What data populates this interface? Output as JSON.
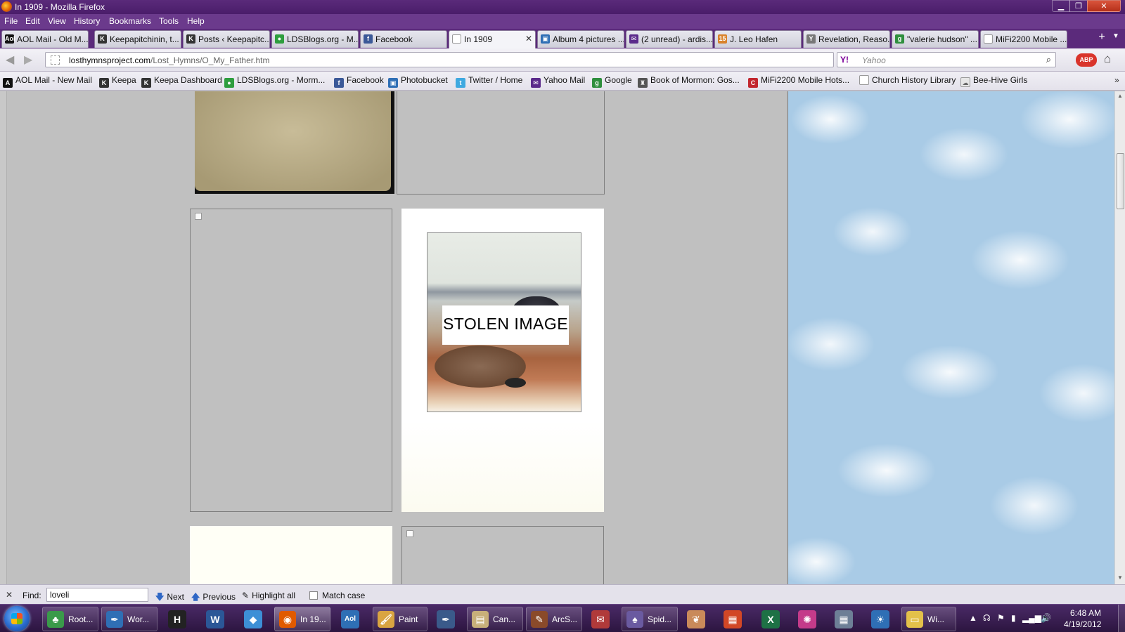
{
  "window": {
    "title": "In 1909 - Mozilla Firefox",
    "minimize_glyph": "▁",
    "maximize_glyph": "❐",
    "close_glyph": "✕"
  },
  "menu": [
    "File",
    "Edit",
    "View",
    "History",
    "Bookmarks",
    "Tools",
    "Help"
  ],
  "tabs": [
    {
      "label": "AOL Mail - Old M...",
      "icon": "aol-icon",
      "icon_text": "Aol",
      "icon_color": "#111111"
    },
    {
      "label": "Keepapitchinin, t...",
      "icon": "keepa-icon",
      "icon_text": "K",
      "icon_color": "#333333"
    },
    {
      "label": "Posts ‹ Keepapitc...",
      "icon": "keepa-icon",
      "icon_text": "K",
      "icon_color": "#333333"
    },
    {
      "label": "LDSBlogs.org - M...",
      "icon": "ldsblogs-icon",
      "icon_text": "●",
      "icon_color": "#2e9e3e"
    },
    {
      "label": "Facebook",
      "icon": "facebook-icon",
      "icon_text": "f",
      "icon_color": "#3b5998"
    },
    {
      "label": "In 1909",
      "icon": "blank-page-icon",
      "icon_text": "",
      "icon_color": "#ffffff",
      "active": true,
      "close": "✕"
    },
    {
      "label": "Album 4 pictures ...",
      "icon": "album-icon",
      "icon_text": "▣",
      "icon_color": "#2f6fb5"
    },
    {
      "label": "(2 unread) - ardis...",
      "icon": "mail-icon",
      "icon_text": "✉",
      "icon_color": "#5b2a8b"
    },
    {
      "label": "J. Leo Hafen",
      "icon": "hafen-icon",
      "icon_text": "15",
      "icon_color": "#d9822b"
    },
    {
      "label": "Revelation, Reaso...",
      "icon": "ycombinator-icon",
      "icon_text": "Y",
      "icon_color": "#777777"
    },
    {
      "label": "\"valerie hudson\" ...",
      "icon": "google-icon",
      "icon_text": "g",
      "icon_color": "#2f8f3e"
    },
    {
      "label": "MiFi2200 Mobile ...",
      "icon": "blank-page-icon",
      "icon_text": "",
      "icon_color": "#ffffff"
    }
  ],
  "new_tab_glyph": "+",
  "tab_list_glyph": "▼",
  "nav": {
    "back_glyph": "◀",
    "forward_glyph": "▶",
    "url_domain": "losthymnsproject.com",
    "url_path": "/Lost_Hymns/O_My_Father.htm",
    "star_glyph": "☆",
    "dropdown_glyph": "▽",
    "reload_glyph": "↻",
    "search_engine": "Y!",
    "search_placeholder": "Yahoo",
    "search_glyph": "⌕",
    "abp_label": "ABP",
    "home_glyph": "⌂"
  },
  "bookmarks": [
    {
      "label": "AOL Mail - New Mail",
      "icon": "aol-icon",
      "icon_text": "A",
      "icon_color": "#111111"
    },
    {
      "label": "Keepa",
      "icon": "keepa-icon",
      "icon_text": "K",
      "icon_color": "#333333"
    },
    {
      "label": "Keepa Dashboard",
      "icon": "keepa-icon",
      "icon_text": "K",
      "icon_color": "#333333"
    },
    {
      "label": "LDSBlogs.org - Morm...",
      "icon": "ldsblogs-icon",
      "icon_text": "●",
      "icon_color": "#2e9e3e"
    },
    {
      "label": "Facebook",
      "icon": "facebook-icon",
      "icon_text": "f",
      "icon_color": "#3b5998"
    },
    {
      "label": "Photobucket",
      "icon": "photobucket-icon",
      "icon_text": "▣",
      "icon_color": "#2f6fb5"
    },
    {
      "label": "Twitter / Home",
      "icon": "twitter-icon",
      "icon_text": "t",
      "icon_color": "#3fa9e0"
    },
    {
      "label": "Yahoo Mail",
      "icon": "yahoo-mail-icon",
      "icon_text": "✉",
      "icon_color": "#5b2a8b"
    },
    {
      "label": "Google",
      "icon": "google-icon",
      "icon_text": "g",
      "icon_color": "#2f8f3e"
    },
    {
      "label": "Book of Mormon: Gos...",
      "icon": "book-icon",
      "icon_text": "♜",
      "icon_color": "#555555"
    },
    {
      "label": "MiFi2200 Mobile Hots...",
      "icon": "mifi-icon",
      "icon_text": "C",
      "icon_color": "#c2262e"
    },
    {
      "label": "Church History Library",
      "icon": "blank-page-icon",
      "icon_text": "",
      "icon_color": "#ffffff"
    },
    {
      "label": "Bee-Hive Girls",
      "icon": "cloud-icon",
      "icon_text": "☁",
      "icon_color": "#e6e6e6"
    }
  ],
  "bookmarks_more_glyph": "»",
  "content": {
    "stolen_image_label": "STOLEN IMAGE",
    "scroll_up_glyph": "▲",
    "scroll_down_glyph": "▼"
  },
  "findbar": {
    "close_glyph": "✕",
    "label": "Find:",
    "query": "loveli",
    "next_label": "Next",
    "next_glyph": "🡇",
    "previous_label": "Previous",
    "previous_glyph": "🡅",
    "highlight_label": "Highlight all",
    "highlight_glyph": "✎",
    "match_case_label": "Match case"
  },
  "taskbar": {
    "buttons": [
      {
        "label": "Root...",
        "icon": "rootsmagic-icon",
        "icon_text": "♣",
        "icon_color": "#3a9a4a"
      },
      {
        "label": "Wor...",
        "icon": "wordpad-icon",
        "icon_text": "✒",
        "icon_color": "#2f6fb5"
      },
      {
        "label": "In 19...",
        "icon": "firefox-icon",
        "icon_text": "◉",
        "icon_color": "#e05a00",
        "active": true
      },
      {
        "label": "Paint",
        "icon": "paint-icon",
        "icon_text": "🖌",
        "icon_color": "#d9a441"
      },
      {
        "label": "Can...",
        "icon": "scanner-icon",
        "icon_text": "▤",
        "icon_color": "#c8b07a"
      },
      {
        "label": "ArcS...",
        "icon": "arcsoft-icon",
        "icon_text": "✎",
        "icon_color": "#8a4a2a"
      },
      {
        "label": "Spid...",
        "icon": "spider-solitaire-icon",
        "icon_text": "♠",
        "icon_color": "#6a5aa0"
      },
      {
        "label": "Wi...",
        "icon": "explorer-folder-icon",
        "icon_text": "▭",
        "icon_color": "#e3c14a"
      }
    ],
    "pinned": [
      {
        "name": "h-app-icon",
        "icon_text": "H",
        "icon_color": "#222222"
      },
      {
        "name": "word-icon",
        "icon_text": "W",
        "icon_color": "#2b5797"
      },
      {
        "name": "dropbox-icon",
        "icon_text": "◆",
        "icon_color": "#3d8fd6"
      },
      {
        "name": "aol-icon",
        "icon_text": "Aol",
        "icon_color": "#2f6fb5"
      },
      {
        "name": "pen-icon",
        "icon_text": "✒",
        "icon_color": "#3a5a8a"
      },
      {
        "name": "mail-icon",
        "icon_text": "✉",
        "icon_color": "#b03a3a"
      },
      {
        "name": "tarot-icon",
        "icon_text": "❦",
        "icon_color": "#c98a5a"
      },
      {
        "name": "presentation-icon",
        "icon_text": "▦",
        "icon_color": "#d24726"
      },
      {
        "name": "excel-icon",
        "icon_text": "X",
        "icon_color": "#1e7145"
      },
      {
        "name": "picasa-icon",
        "icon_text": "✺",
        "icon_color": "#c43b8a"
      },
      {
        "name": "calculator-icon",
        "icon_text": "▦",
        "icon_color": "#6d7f96"
      },
      {
        "name": "sun-icon",
        "icon_text": "☀",
        "icon_color": "#2f6fb5"
      }
    ],
    "tray_glyphs": [
      "▲",
      "☊",
      "⚑",
      "▮",
      "▂▄▆",
      "🔊"
    ],
    "time": "6:48 AM",
    "date": "4/19/2012"
  }
}
